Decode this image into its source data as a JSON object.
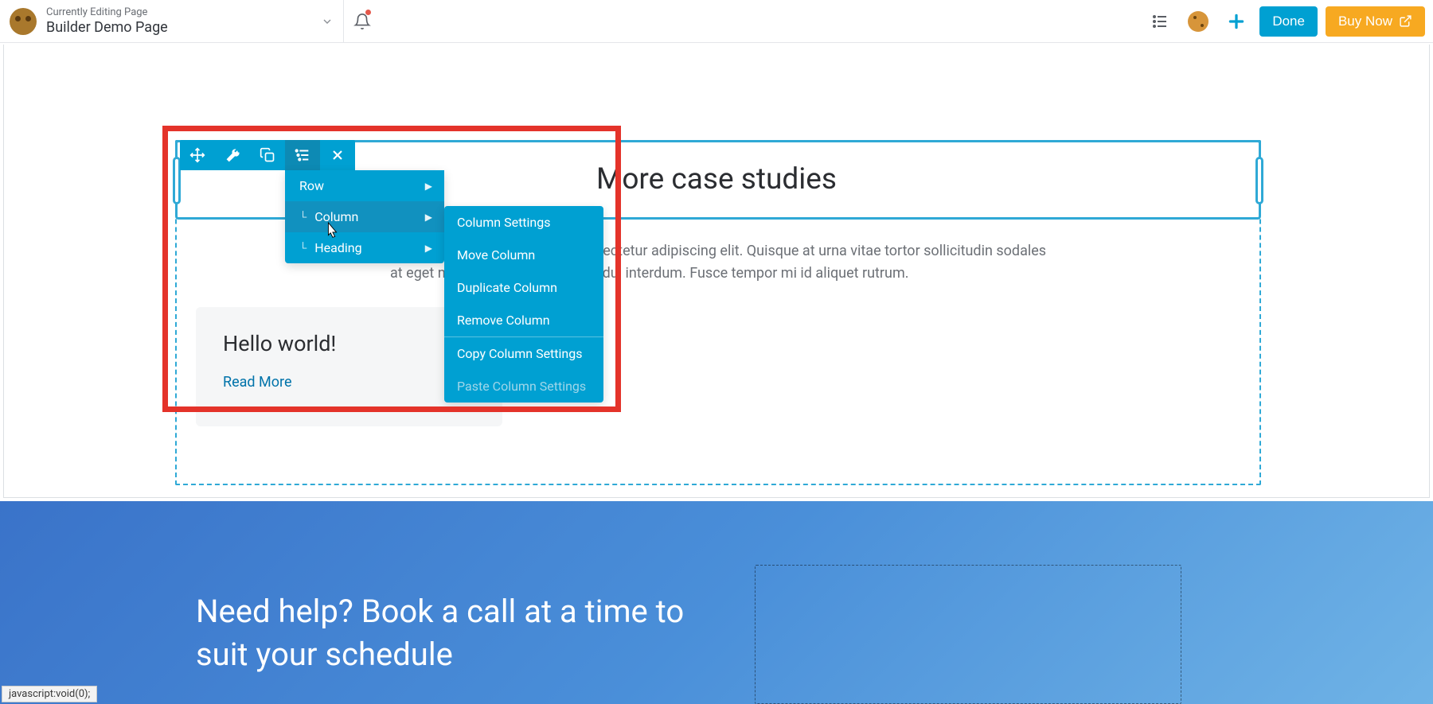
{
  "header": {
    "subtitle": "Currently Editing Page",
    "title": "Builder Demo Page",
    "done_label": "Done",
    "buy_label": "Buy Now"
  },
  "content": {
    "heading": "More case studies",
    "paragraph": "Lorem ipsum dolor sit amet, consectetur adipiscing elit. Quisque at urna vitae tortor sollicitudin sodales at eget neque. Donec ut orci quis dui interdum. Fusce tempor mi id aliquet rutrum.",
    "card": {
      "title": "Hello world!",
      "link": "Read More"
    },
    "cta_heading": "Need help? Book a call at a time to suit your schedule"
  },
  "toolbar": {
    "breadcrumb": {
      "items": [
        {
          "label": "Row",
          "nested": false
        },
        {
          "label": "Column",
          "nested": true
        },
        {
          "label": "Heading",
          "nested": true
        }
      ]
    },
    "submenu": {
      "items": [
        "Column Settings",
        "Move Column",
        "Duplicate Column",
        "Remove Column"
      ],
      "copy": "Copy Column Settings",
      "paste": "Paste Column Settings"
    }
  },
  "status": {
    "text": "javascript:void(0);"
  }
}
